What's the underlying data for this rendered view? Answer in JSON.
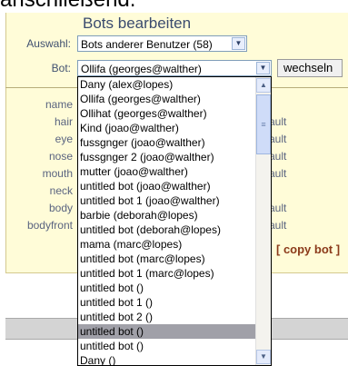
{
  "top_text": "anschließend.",
  "panel": {
    "title": "Bots bearbeiten",
    "auswahl_label": "Auswahl:",
    "auswahl_value": "Bots anderer Benutzer (58)",
    "bot_label": "Bot:",
    "bot_value": "Ollifa (georges@walther)",
    "switch_button": "wechseln",
    "copy_link": "[ copy bot ]"
  },
  "attributes": [
    {
      "label": "name",
      "value": ""
    },
    {
      "label": "hair",
      "value": "ault"
    },
    {
      "label": "eye",
      "value": "ault"
    },
    {
      "label": "nose",
      "value": "ault"
    },
    {
      "label": "mouth",
      "value": "ault"
    },
    {
      "label": "neck",
      "value": ""
    },
    {
      "label": "body",
      "value": "ault"
    },
    {
      "label": "bodyfront",
      "value": "ault"
    }
  ],
  "dropdown_items": [
    "Dany (alex@lopes)",
    "Ollifa (georges@walther)",
    "Ollihat (georges@walther)",
    "Kind (joao@walther)",
    "fussgnger (joao@walther)",
    "fussgnger 2 (joao@walther)",
    "mutter (joao@walther)",
    "untitled bot (joao@walther)",
    "untitled bot 1 (joao@walther)",
    "barbie (deborah@lopes)",
    "untitled bot (deborah@lopes)",
    "mama (marc@lopes)",
    "untitled bot (marc@lopes)",
    "untitled bot 1 (marc@lopes)",
    "untitled bot ()",
    "untitled bot 1 ()",
    "untitled bot 2 ()",
    "untitled bot ()",
    "untitled bot ()",
    "Dany ()"
  ],
  "selected_index": 17,
  "icons": {
    "arrow_down": "▼",
    "arrow_up": "▲",
    "grip": "≡"
  }
}
